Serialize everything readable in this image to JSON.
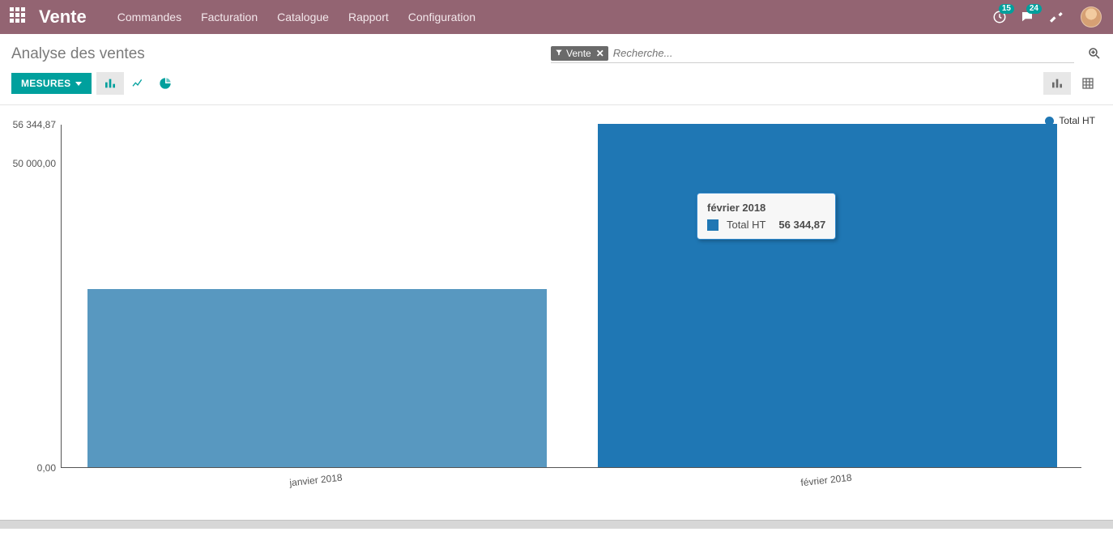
{
  "nav": {
    "brand": "Vente",
    "menu": [
      "Commandes",
      "Facturation",
      "Catalogue",
      "Rapport",
      "Configuration"
    ],
    "badge_clock": "15",
    "badge_msg": "24"
  },
  "breadcrumb": {
    "title": "Analyse des ventes"
  },
  "search": {
    "tag_label": "Vente",
    "placeholder": "Recherche..."
  },
  "toolbar": {
    "measures_label": "MESURES"
  },
  "legend": {
    "series_name": "Total HT"
  },
  "tooltip": {
    "title": "février 2018",
    "series": "Total HT",
    "value": "56 344,87"
  },
  "colors": {
    "accent": "#00A09D",
    "navbar": "#936472",
    "bar1": "#5898c0",
    "bar2": "#1f77b4",
    "legend_dot": "#1f77b4"
  },
  "chart_data": {
    "type": "bar",
    "categories": [
      "janvier 2018",
      "février 2018"
    ],
    "series": [
      {
        "name": "Total HT",
        "values": [
          29200,
          56344.87
        ]
      }
    ],
    "title": "",
    "xlabel": "",
    "ylabel": "",
    "ylim": [
      0,
      56344.87
    ],
    "yticks": [
      {
        "value": 0,
        "label": "0,00"
      },
      {
        "value": 50000,
        "label": "50 000,00"
      },
      {
        "value": 56344.87,
        "label": "56 344,87"
      }
    ]
  }
}
